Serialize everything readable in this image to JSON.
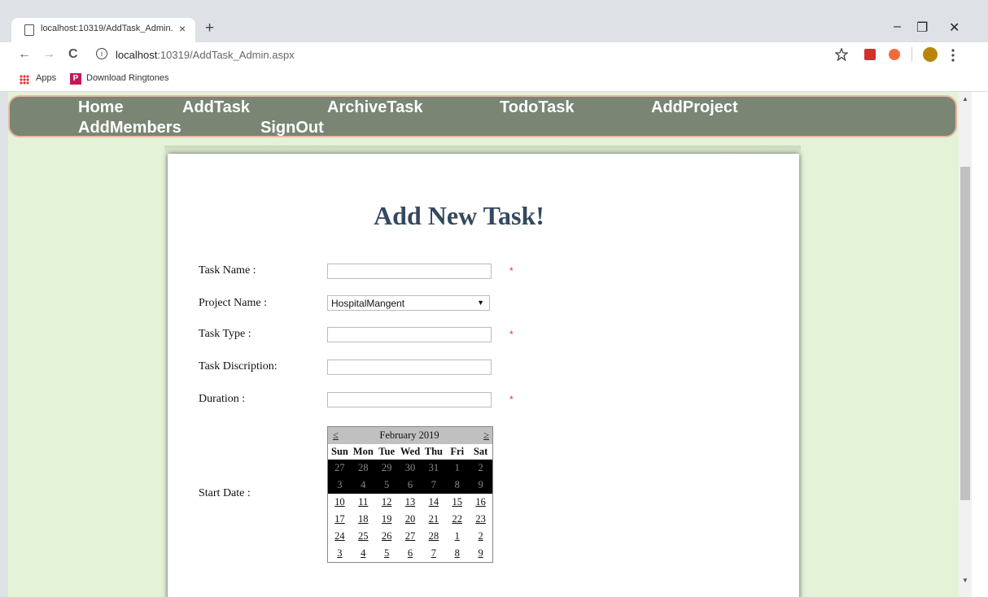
{
  "browser": {
    "tab_title": "localhost:10319/AddTask_Admin.",
    "tab_close": "×",
    "new_tab": "+",
    "window_controls": {
      "minimize": "–",
      "restore": "❐",
      "close": "✕"
    },
    "back": "←",
    "forward": "→",
    "reload": "C",
    "url_host": "localhost",
    "url_rest": ":10319/AddTask_Admin.aspx",
    "bookmarks": [
      {
        "label": "Apps",
        "icon": "apps-grid-icon"
      },
      {
        "label": "Download Ringtones",
        "icon": "ringtone-icon"
      }
    ],
    "toolbar_icons": [
      "star-icon",
      "pdf-extension-icon",
      "block-extension-icon",
      "profile-avatar-icon",
      "menu-dots-icon"
    ],
    "colors": {
      "tabstrip": "#dee1e6",
      "accent_pdf": "#d32f2f",
      "accent_block": "#f26b3a"
    }
  },
  "nav": {
    "links": [
      "Home",
      "AddTask",
      "ArchiveTask",
      "TodoTask",
      "AddProject",
      "AddMembers",
      "SignOut"
    ],
    "colors": {
      "bar": "#7a8574",
      "border": "#e8b8a4",
      "text": "#ffffff"
    }
  },
  "form": {
    "heading": "Add New Task!",
    "task_name": {
      "label": "Task Name :",
      "value": "",
      "required_mark": "*"
    },
    "project_name": {
      "label": "Project Name :",
      "selected": "HospitalMangent",
      "arrow": "▼"
    },
    "task_type": {
      "label": "Task Type :",
      "value": "",
      "required_mark": "*"
    },
    "task_description": {
      "label": "Task Discription:",
      "value": ""
    },
    "duration": {
      "label": "Duration :",
      "value": "",
      "required_mark": "*"
    },
    "start_date": {
      "label": "Start Date :"
    },
    "colors": {
      "heading": "#34495e",
      "required": "#e0302f",
      "page_bg": "#e4f2d8"
    }
  },
  "calendar": {
    "prev": "≤",
    "next": "≥",
    "month": "February 2019",
    "days": [
      "Sun",
      "Mon",
      "Tue",
      "Wed",
      "Thu",
      "Fri",
      "Sat"
    ],
    "weeks": [
      [
        "27",
        "28",
        "29",
        "30",
        "31",
        "1",
        "2"
      ],
      [
        "3",
        "4",
        "5",
        "6",
        "7",
        "8",
        "9"
      ],
      [
        "10",
        "11",
        "12",
        "13",
        "14",
        "15",
        "16"
      ],
      [
        "17",
        "18",
        "19",
        "20",
        "21",
        "22",
        "23"
      ],
      [
        "24",
        "25",
        "26",
        "27",
        "28",
        "1",
        "2"
      ],
      [
        "3",
        "4",
        "5",
        "6",
        "7",
        "8",
        "9"
      ]
    ],
    "disabled_weeks": [
      0,
      1
    ]
  }
}
